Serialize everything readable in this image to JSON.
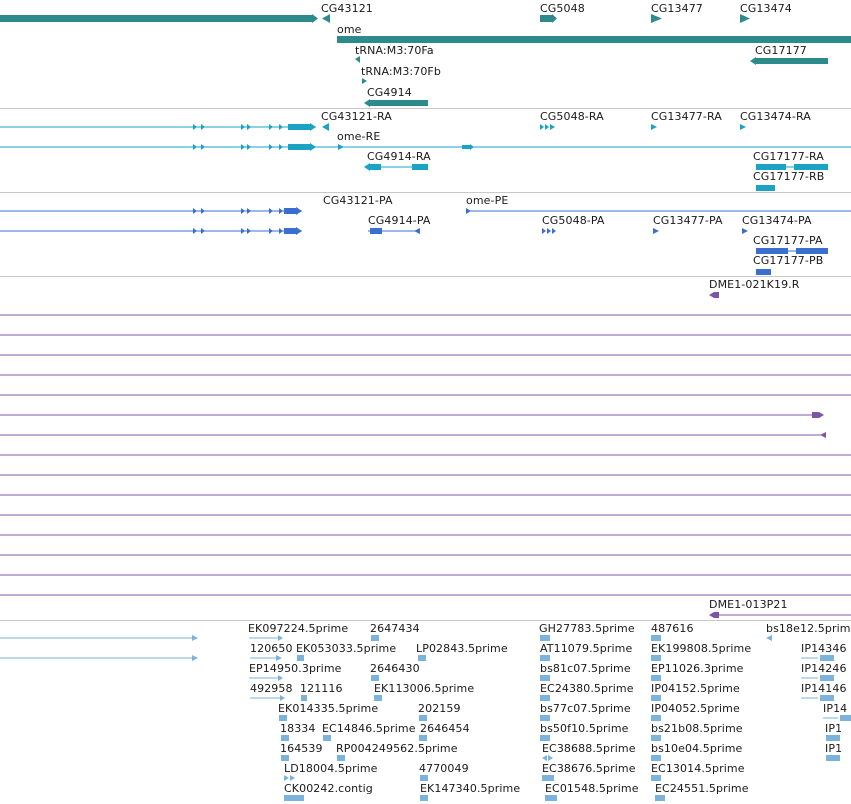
{
  "colors": {
    "gene": "#2e8b8b",
    "transcript": "#1aa3c3",
    "protein": "#3a6fd0",
    "clone": "#7d55a6",
    "est": "#7bb3dd",
    "separator": "#c9c9c9",
    "text": "#1a1a1a"
  },
  "tracks": {
    "genes": {
      "labels": [
        "CG43121",
        "CG5048",
        "CG13477",
        "CG13474",
        "ome",
        "tRNA:M3:70Fa",
        "CG17177",
        "tRNA:M3:70Fb",
        "CG4914"
      ]
    },
    "transcripts": {
      "labels": [
        "CG43121-RA",
        "CG5048-RA",
        "CG13477-RA",
        "CG13474-RA",
        "ome-RE",
        "CG4914-RA",
        "CG17177-RA",
        "CG17177-RB"
      ]
    },
    "proteins": {
      "labels": [
        "CG43121-PA",
        "ome-PE",
        "CG4914-PA",
        "CG5048-PA",
        "CG13477-PA",
        "CG13474-PA",
        "CG17177-PA",
        "CG17177-PB"
      ]
    },
    "clones": {
      "labels": [
        "DME1-021K19.R",
        "DME1-013P21"
      ]
    },
    "ests": {
      "labels": [
        "EK097224.5prime",
        "2647434",
        "GH27783.5prime",
        "487616",
        "bs18e12.5prime",
        "120650",
        "EK053033.5prime",
        "LP02843.5prime",
        "AT11079.5prime",
        "EK199808.5prime",
        "IP14346",
        "EP14950.3prime",
        "2646430",
        "bs81c07.5prime",
        "EP11026.3prime",
        "IP14246",
        "492958",
        "121116",
        "EK113006.5prime",
        "EC24380.5prime",
        "IP04152.5prime",
        "IP14146",
        "EK014335.5prime",
        "202159",
        "bs77c07.5prime",
        "IP04052.5prime",
        "IP14",
        "18334",
        "EC14846.5prime",
        "2646454",
        "bs50f10.5prime",
        "bs21b08.5prime",
        "IP1",
        "164539",
        "RP004249562.5prime",
        "EC38688.5prime",
        "bs10e04.5prime",
        "IP1",
        "LD18004.5prime",
        "4770049",
        "EC38676.5prime",
        "EC13014.5prime",
        "CK00242.contig",
        "EK147340.5prime",
        "EC01548.5prime",
        "EC24551.5prime"
      ]
    }
  }
}
